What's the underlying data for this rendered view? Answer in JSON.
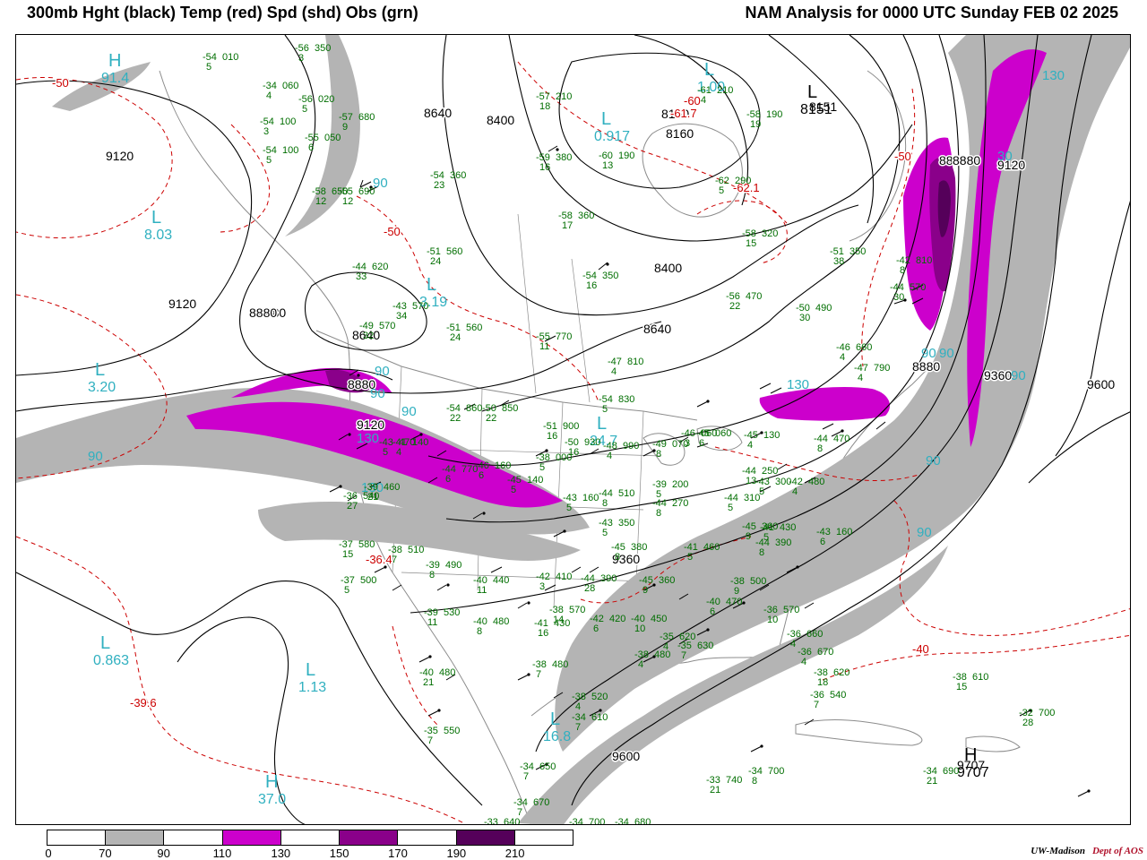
{
  "header": {
    "left_title": "300mb Hght (black) Temp (red) Spd (shd) Obs (grn)",
    "right_title": "NAM Analysis for 0000 UTC Sunday  FEB 02 2025"
  },
  "colors": {
    "height_contour": "#000000",
    "temperature_contour": "#cc0000",
    "speed_70_90": "#b4b4b4",
    "speed_110_130": "#cc00cc",
    "speed_150_170": "#8a008a",
    "speed_190_210": "#55005a",
    "speed_label": "#30b0c0",
    "observations": "#006e00",
    "geography": "#8c8c8c"
  },
  "colorbar": {
    "ticks": [
      "0",
      "70",
      "90",
      "110",
      "130",
      "150",
      "170",
      "190",
      "210"
    ],
    "segments": [
      "#ffffff",
      "#b4b4b4",
      "#ffffff",
      "#cc00cc",
      "#ffffff",
      "#8a008a",
      "#ffffff",
      "#55005a",
      "#ffffff"
    ]
  },
  "credit": {
    "org": "UW-Madison",
    "dept": "Dept of AOS"
  },
  "height_labels": [
    "9120",
    "9120",
    "8880",
    "8640",
    "8400",
    "8160",
    "8160",
    "8640",
    "8400",
    "8640",
    "8880",
    "9120",
    "9360",
    "9600",
    "8880",
    "9360",
    "9600",
    "9707",
    "8880",
    "8880",
    "8151",
    "9120",
    "8880"
  ],
  "temp_labels": [
    "-50",
    "-60",
    "-61.7",
    "-62.1",
    "-50",
    "-50",
    "-40",
    "-36.4",
    "-39.6"
  ],
  "pressure_centers": [
    {
      "letter": "H",
      "value": "91.4"
    },
    {
      "letter": "L",
      "value": "8.03"
    },
    {
      "letter": "L",
      "value": "3.20"
    },
    {
      "letter": "L",
      "value": "0.863"
    },
    {
      "letter": "L",
      "value": "1.13"
    },
    {
      "letter": "H",
      "value": "37.0"
    },
    {
      "letter": "L",
      "value": "3.19"
    },
    {
      "letter": "L",
      "value": "0.917"
    },
    {
      "letter": "L",
      "value": "1.00"
    },
    {
      "letter": "L",
      "value": "24.7"
    },
    {
      "letter": "L",
      "value": "16.8"
    },
    {
      "letter": "H",
      "value": "9707"
    },
    {
      "letter": "L",
      "value": "8151"
    }
  ],
  "speed_labels": [
    "90",
    "90",
    "90",
    "130",
    "130",
    "90",
    "90",
    "90",
    "90",
    "130",
    "90",
    "130",
    "90",
    "90",
    "30"
  ],
  "observations": [
    {
      "t": "-54",
      "h": "010",
      "d": "5"
    },
    {
      "t": "-56",
      "h": "350",
      "d": "3"
    },
    {
      "t": "-34",
      "h": "060",
      "d": "4"
    },
    {
      "t": "-56",
      "h": "020",
      "d": "5"
    },
    {
      "t": "-57",
      "h": "680",
      "d": "9"
    },
    {
      "t": "-54",
      "h": "100",
      "d": "3"
    },
    {
      "t": "-55",
      "h": "050",
      "d": "6"
    },
    {
      "t": "-54",
      "h": "100",
      "d": "5"
    },
    {
      "t": "-58",
      "h": "650",
      "d": "12"
    },
    {
      "t": "-54",
      "h": "360",
      "d": "23"
    },
    {
      "t": "-57",
      "h": "210",
      "d": "18"
    },
    {
      "t": "-59",
      "h": "380",
      "d": "16"
    },
    {
      "t": "-60",
      "h": "190",
      "d": "13"
    },
    {
      "t": "-61",
      "h": "210",
      "d": "4"
    },
    {
      "t": "-58",
      "h": "190",
      "d": "19"
    },
    {
      "t": "-62",
      "h": "290",
      "d": "5"
    },
    {
      "t": "-58",
      "h": "360",
      "d": "17"
    },
    {
      "t": "-58",
      "h": "320",
      "d": "15"
    },
    {
      "t": "-55",
      "h": "690",
      "d": "12"
    },
    {
      "t": "-44",
      "h": "620",
      "d": "33"
    },
    {
      "t": "-51",
      "h": "560",
      "d": "24"
    },
    {
      "t": "-43",
      "h": "570",
      "d": "34"
    },
    {
      "t": "-51",
      "h": "560",
      "d": "24"
    },
    {
      "t": "-49",
      "h": "570",
      "d": "32"
    },
    {
      "t": "-55",
      "h": "770",
      "d": "11"
    },
    {
      "t": "-54",
      "h": "350",
      "d": "16"
    },
    {
      "t": "-56",
      "h": "470",
      "d": "22"
    },
    {
      "t": "-50",
      "h": "490",
      "d": "30"
    },
    {
      "t": "-51",
      "h": "350",
      "d": "38"
    },
    {
      "t": "-44",
      "h": "570",
      "d": "30"
    },
    {
      "t": "-42",
      "h": "810",
      "d": "8"
    },
    {
      "t": "-46",
      "h": "660",
      "d": "4"
    },
    {
      "t": "-47",
      "h": "790",
      "d": "4"
    },
    {
      "t": "-47",
      "h": "810",
      "d": "4"
    },
    {
      "t": "-54",
      "h": "830",
      "d": "5"
    },
    {
      "t": "-54",
      "h": "860",
      "d": "22"
    },
    {
      "t": "-50",
      "h": "850",
      "d": "22"
    },
    {
      "t": "-51",
      "h": "900",
      "d": "16"
    },
    {
      "t": "-50",
      "h": "930",
      "d": "16"
    },
    {
      "t": "-48",
      "h": "990",
      "d": "4"
    },
    {
      "t": "-49",
      "h": "070",
      "d": "8"
    },
    {
      "t": "-46",
      "h": "060",
      "d": "3"
    },
    {
      "t": "-45",
      "h": "060",
      "d": "6"
    },
    {
      "t": "-45",
      "h": "130",
      "d": "4"
    },
    {
      "t": "-44",
      "h": "470",
      "d": "8"
    },
    {
      "t": "-44",
      "h": "250",
      "d": "13"
    },
    {
      "t": "-43",
      "h": "300",
      "d": "5"
    },
    {
      "t": "-42",
      "h": "480",
      "d": "4"
    },
    {
      "t": "-43",
      "h": "470",
      "d": "5"
    },
    {
      "t": "-38",
      "h": "000",
      "d": "5"
    },
    {
      "t": "-39",
      "h": "200",
      "d": "5"
    },
    {
      "t": "-44",
      "h": "270",
      "d": "8"
    },
    {
      "t": "-44",
      "h": "310",
      "d": "5"
    },
    {
      "t": "-45",
      "h": "360",
      "d": "9"
    },
    {
      "t": "-44",
      "h": "390",
      "d": "8"
    },
    {
      "t": "-41",
      "h": "430",
      "d": "5"
    },
    {
      "t": "-43",
      "h": "160",
      "d": "6"
    },
    {
      "t": "-41",
      "h": "140",
      "d": "4"
    },
    {
      "t": "-46",
      "h": "160",
      "d": "6"
    },
    {
      "t": "-45",
      "h": "140",
      "d": "5"
    },
    {
      "t": "-44",
      "h": "770",
      "d": "6"
    },
    {
      "t": "-43",
      "h": "160",
      "d": "5"
    },
    {
      "t": "-44",
      "h": "510",
      "d": "8"
    },
    {
      "t": "-43",
      "h": "350",
      "d": "5"
    },
    {
      "t": "-45",
      "h": "380",
      "d": "8"
    },
    {
      "t": "-41",
      "h": "460",
      "d": "5"
    },
    {
      "t": "-39",
      "h": "460",
      "d": "21"
    },
    {
      "t": "-36",
      "h": "540",
      "d": "27"
    },
    {
      "t": "-37",
      "h": "580",
      "d": "15"
    },
    {
      "t": "-37",
      "h": "500",
      "d": "5"
    },
    {
      "t": "-38",
      "h": "510",
      "d": "7"
    },
    {
      "t": "-39",
      "h": "490",
      "d": "8"
    },
    {
      "t": "-40",
      "h": "440",
      "d": "11"
    },
    {
      "t": "-42",
      "h": "410",
      "d": "3"
    },
    {
      "t": "-44",
      "h": "390",
      "d": "28"
    },
    {
      "t": "-45",
      "h": "360",
      "d": "9"
    },
    {
      "t": "-38",
      "h": "570",
      "d": "14"
    },
    {
      "t": "-39",
      "h": "530",
      "d": "11"
    },
    {
      "t": "-40",
      "h": "480",
      "d": "8"
    },
    {
      "t": "-41",
      "h": "430",
      "d": "16"
    },
    {
      "t": "-42",
      "h": "420",
      "d": "6"
    },
    {
      "t": "-40",
      "h": "450",
      "d": "10"
    },
    {
      "t": "-40",
      "h": "470",
      "d": "6"
    },
    {
      "t": "-38",
      "h": "500",
      "d": "9"
    },
    {
      "t": "-36",
      "h": "570",
      "d": "10"
    },
    {
      "t": "-38",
      "h": "610",
      "d": "15"
    },
    {
      "t": "-40",
      "h": "480",
      "d": "21"
    },
    {
      "t": "-38",
      "h": "480",
      "d": "7"
    },
    {
      "t": "-38",
      "h": "520",
      "d": "4"
    },
    {
      "t": "-38",
      "h": "480",
      "d": "4"
    },
    {
      "t": "-35",
      "h": "620",
      "d": "4"
    },
    {
      "t": "-35",
      "h": "630",
      "d": "7"
    },
    {
      "t": "-36",
      "h": "660",
      "d": "4"
    },
    {
      "t": "-36",
      "h": "670",
      "d": "4"
    },
    {
      "t": "-38",
      "h": "620",
      "d": "18"
    },
    {
      "t": "-36",
      "h": "540",
      "d": "7"
    },
    {
      "t": "-35",
      "h": "550",
      "d": "7"
    },
    {
      "t": "-34",
      "h": "610",
      "d": "7"
    },
    {
      "t": "-34",
      "h": "650",
      "d": "7"
    },
    {
      "t": "-34",
      "h": "670",
      "d": "7"
    },
    {
      "t": "-33",
      "h": "640",
      "d": "7"
    },
    {
      "t": "-34",
      "h": "700",
      "d": "19"
    },
    {
      "t": "-34",
      "h": "680",
      "d": "7"
    },
    {
      "t": "-33",
      "h": "740",
      "d": "21"
    },
    {
      "t": "-34",
      "h": "700",
      "d": "8"
    },
    {
      "t": "-34",
      "h": "690",
      "d": "21"
    },
    {
      "t": "-32",
      "h": "700",
      "d": "28"
    }
  ]
}
